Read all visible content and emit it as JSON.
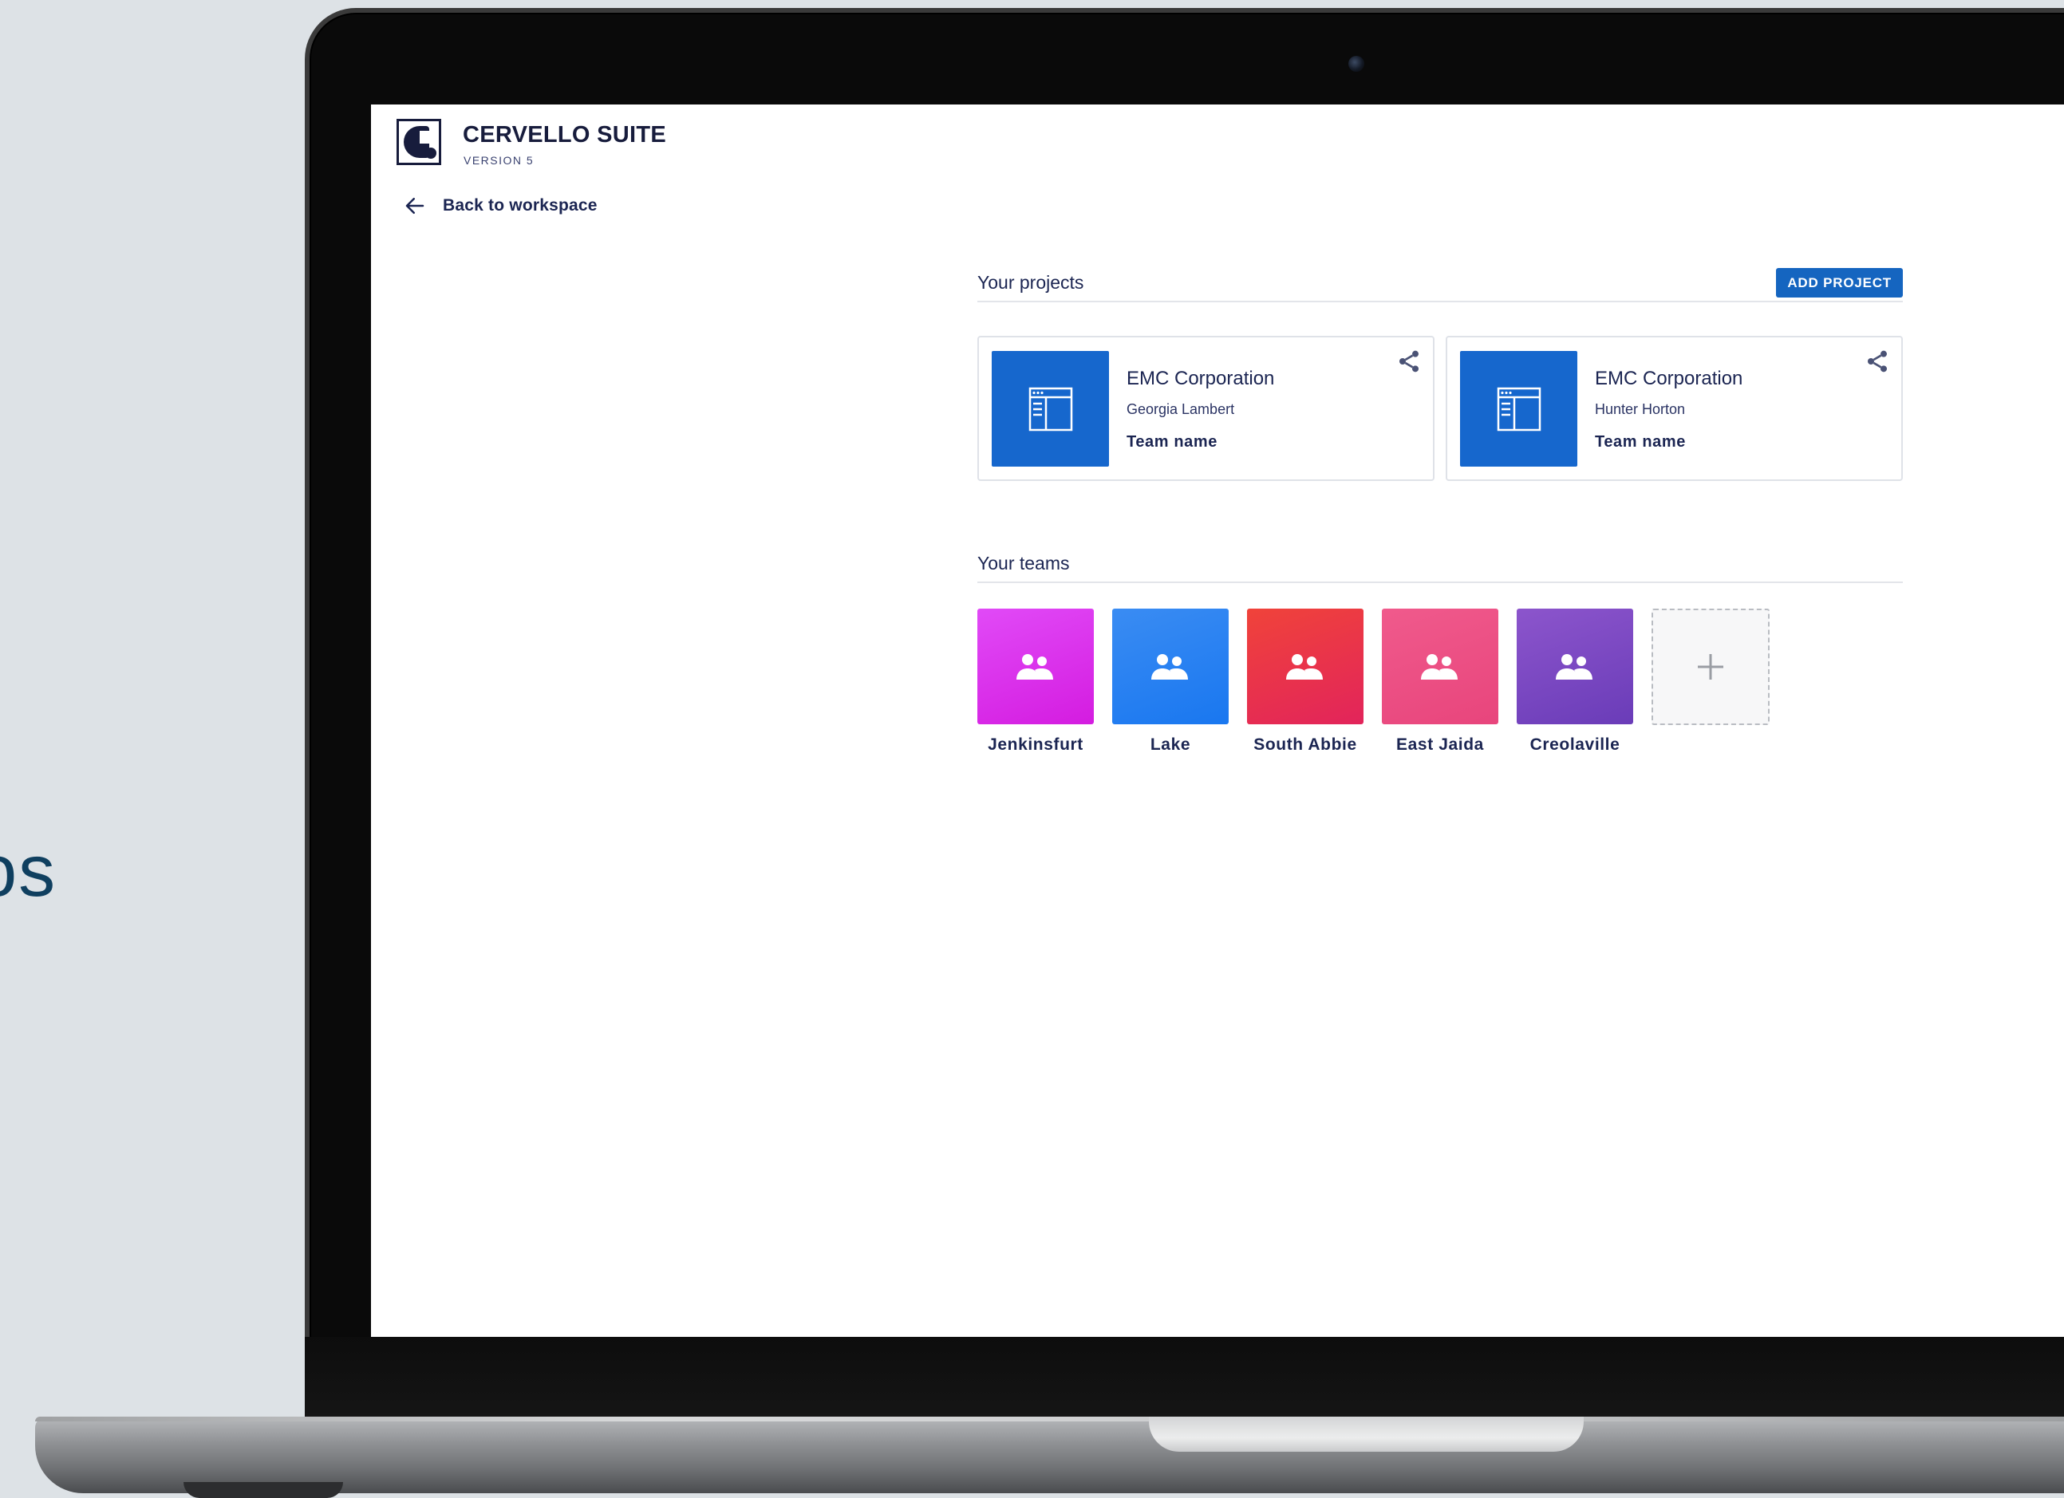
{
  "backdrop": {
    "side_text": "os"
  },
  "app": {
    "title": "CERVELLO SUITE",
    "version": "VERSION 5",
    "logo_icon": "cervello-logo"
  },
  "nav": {
    "back_label": "Back to workspace",
    "back_icon": "arrow-left-icon"
  },
  "projects": {
    "section_title": "Your projects",
    "add_label": "ADD PROJECT",
    "items": [
      {
        "name": "EMC Corporation",
        "owner": "Georgia Lambert",
        "team": "Team name"
      },
      {
        "name": "EMC Corporation",
        "owner": "Hunter Horton",
        "team": "Team name"
      }
    ]
  },
  "teams": {
    "section_title": "Your teams",
    "items": [
      {
        "name": "Jenkinsfurt",
        "color": "#d91ee6"
      },
      {
        "name": "Lake",
        "color": "#1e7df1"
      },
      {
        "name": "South Abbie",
        "color": "#e8344a"
      },
      {
        "name": "East Jaida",
        "color": "#ec5085"
      },
      {
        "name": "Creolaville",
        "color": "#7646c0"
      }
    ],
    "add_icon": "plus-icon"
  },
  "colors": {
    "primary": "#1565c0",
    "text": "#1b2552"
  }
}
